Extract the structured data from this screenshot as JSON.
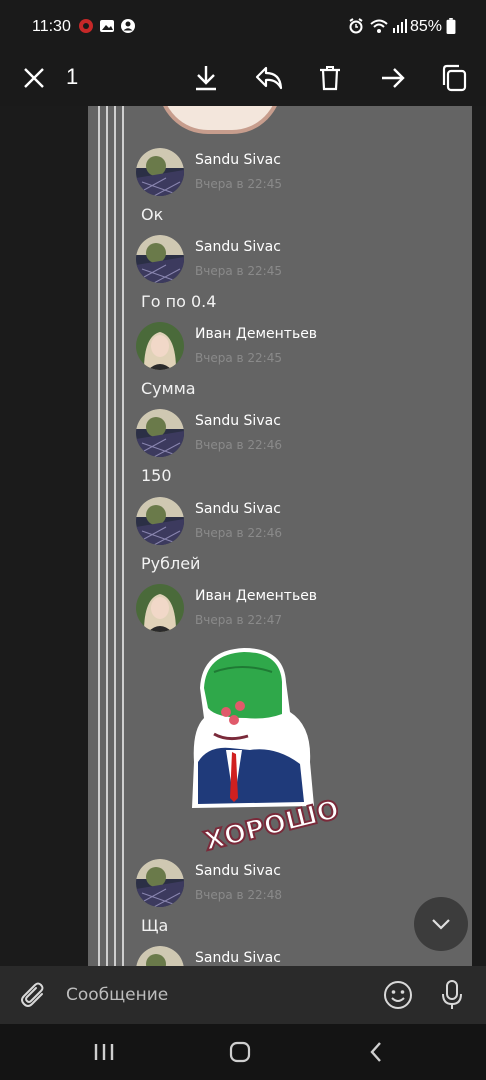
{
  "status_bar": {
    "time": "11:30",
    "battery": "85%",
    "left_icons": [
      "notification-app-icon",
      "gallery-icon",
      "account-icon"
    ],
    "right_icons": [
      "alarm-icon",
      "wifi-icon",
      "signal-icon",
      "battery-icon"
    ]
  },
  "action_bar": {
    "selected_count": "1",
    "icons": [
      "close-icon",
      "download-icon",
      "reply-icon",
      "delete-icon",
      "forward-icon",
      "copy-icon"
    ]
  },
  "messages": [
    {
      "author": "Sandu Sivac",
      "time": "Вчера в 22:45",
      "text": "Ок"
    },
    {
      "author": "Sandu Sivac",
      "time": "Вчера в 22:45",
      "text": "Го по 0.4"
    },
    {
      "author": "Иван Дементьев",
      "time": "Вчера в 22:45",
      "text": "Сумма"
    },
    {
      "author": "Sandu Sivac",
      "time": "Вчера в 22:46",
      "text": "150"
    },
    {
      "author": "Sandu Sivac",
      "time": "Вчера в 22:46",
      "text": "Рублей"
    },
    {
      "author": "Иван Дементьев",
      "time": "Вчера в 22:47",
      "sticker_text": "ХОРОШО"
    },
    {
      "author": "Sandu Sivac",
      "time": "Вчера в 22:48",
      "text": "Ща"
    },
    {
      "author": "Sandu Sivac"
    }
  ],
  "input_bar": {
    "placeholder": "Сообщение",
    "icons": [
      "attach-icon",
      "emoji-icon",
      "microphone-icon"
    ]
  },
  "nav_bar": {
    "icons": [
      "recent-apps-icon",
      "home-icon",
      "back-icon"
    ]
  },
  "colors": {
    "chat_background": "#646464",
    "author_text": "#ffffff",
    "time_text": "#8a8a8a",
    "app_bar": "#1a1a1a"
  }
}
